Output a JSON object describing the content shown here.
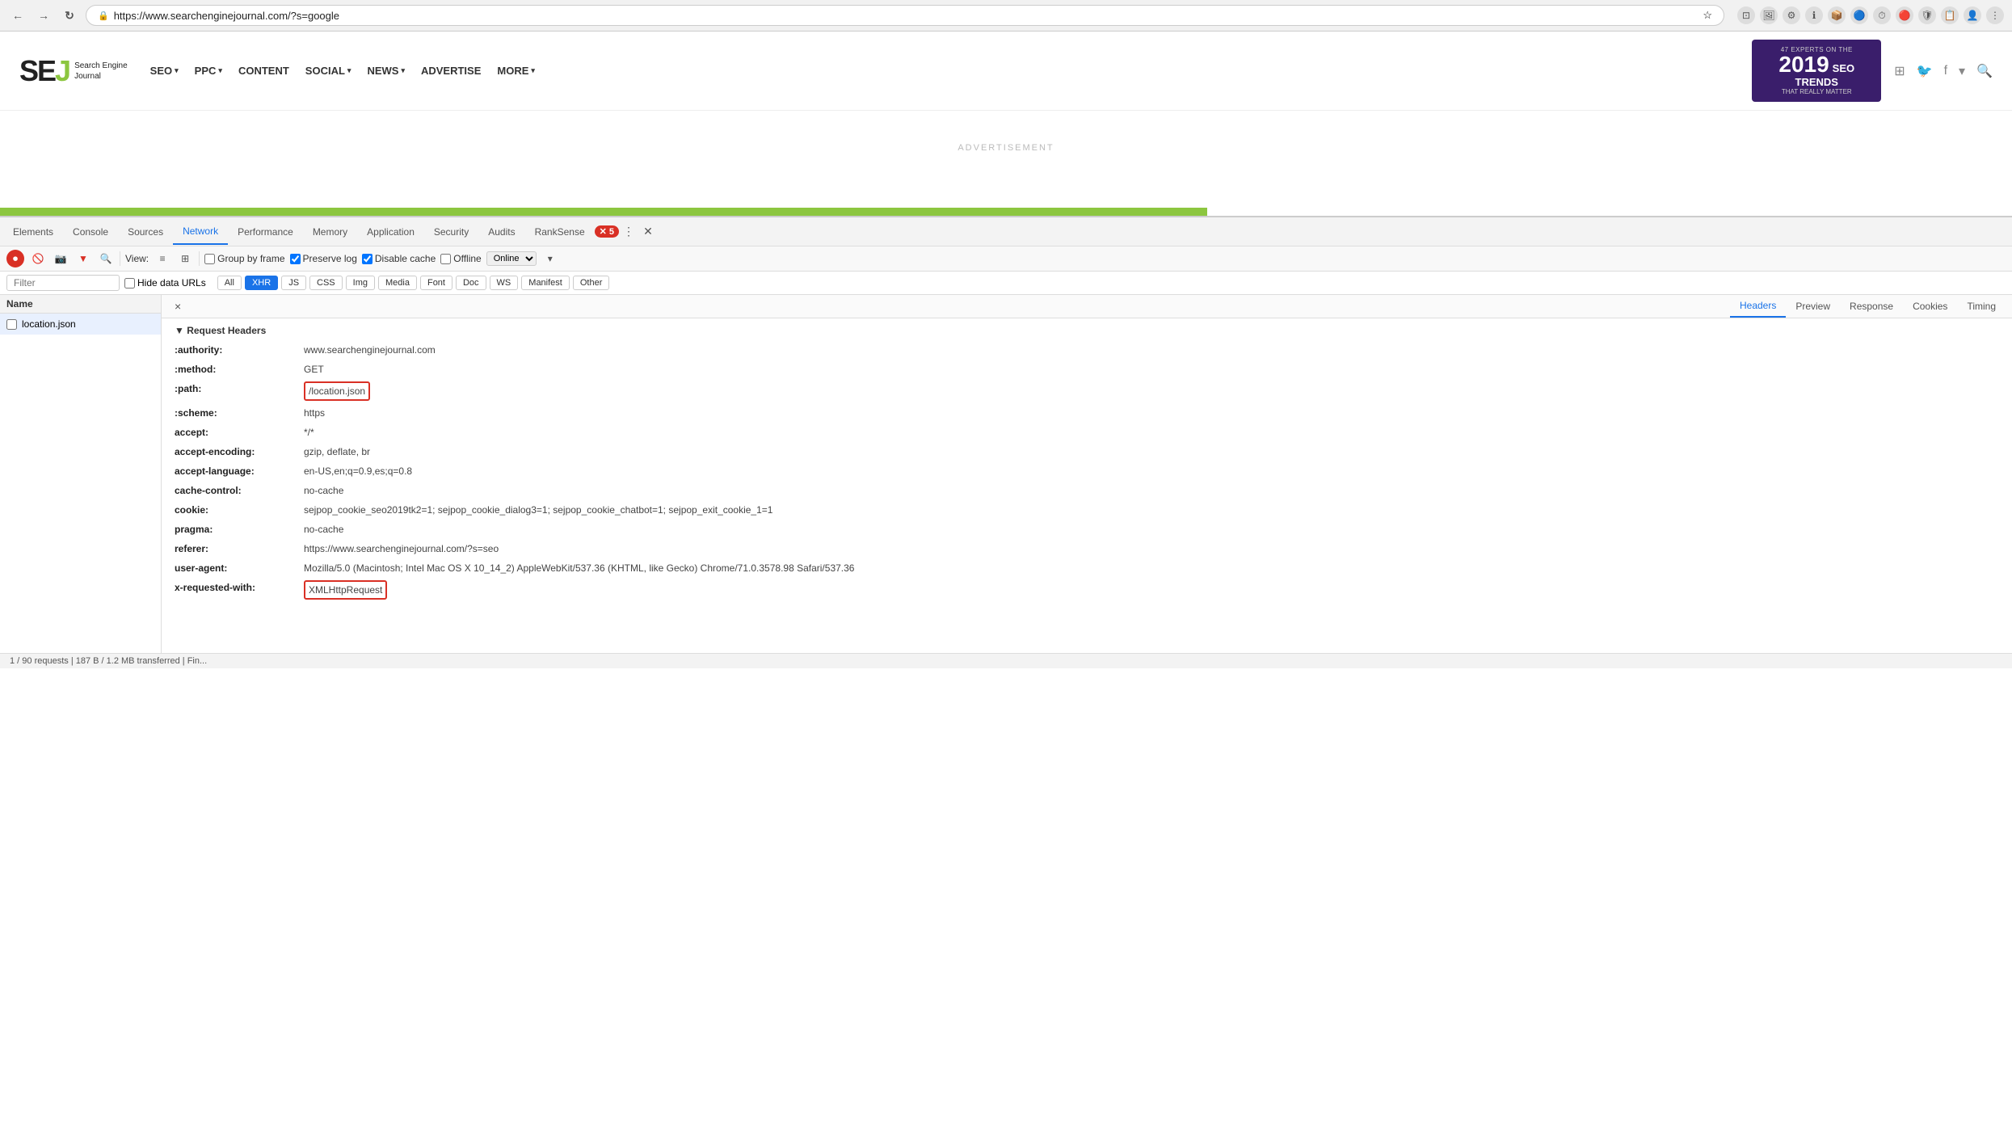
{
  "browser": {
    "url": "https://www.searchenginejournal.com/?s=google",
    "back_label": "←",
    "forward_label": "→",
    "reload_label": "↻",
    "lock_icon": "🔒"
  },
  "site": {
    "logo_se": "SE",
    "logo_j": "J",
    "logo_line1": "Search Engine",
    "logo_line2": "Journal",
    "nav": [
      {
        "label": "SEO",
        "has_arrow": true
      },
      {
        "label": "PPC",
        "has_arrow": true
      },
      {
        "label": "CONTENT",
        "has_arrow": false
      },
      {
        "label": "SOCIAL",
        "has_arrow": true
      },
      {
        "label": "NEWS",
        "has_arrow": true
      },
      {
        "label": "ADVERTISE",
        "has_arrow": false
      },
      {
        "label": "MORE",
        "has_arrow": true
      }
    ],
    "banner": {
      "small_text": "47 EXPERTS ON THE",
      "year": "2019",
      "seo": "SEO",
      "trends": "TRENDS",
      "sub": "THAT REALLY MATTER"
    }
  },
  "advertisement_label": "ADVERTISEMENT",
  "devtools": {
    "tabs": [
      {
        "label": "Elements",
        "active": false
      },
      {
        "label": "Console",
        "active": false
      },
      {
        "label": "Sources",
        "active": false
      },
      {
        "label": "Network",
        "active": true
      },
      {
        "label": "Performance",
        "active": false
      },
      {
        "label": "Memory",
        "active": false
      },
      {
        "label": "Application",
        "active": false
      },
      {
        "label": "Security",
        "active": false
      },
      {
        "label": "Audits",
        "active": false
      },
      {
        "label": "RankSense",
        "active": false
      }
    ],
    "error_count": "5",
    "close_label": "✕",
    "toolbar": {
      "view_label": "View:",
      "group_by_frame": "Group by frame",
      "preserve_log": "Preserve log",
      "disable_cache": "Disable cache",
      "offline_label": "Offline",
      "online_label": "Online"
    },
    "filter": {
      "placeholder": "Filter",
      "hide_data_urls": "Hide data URLs",
      "all_btn": "All",
      "xhr_btn": "XHR",
      "js_btn": "JS",
      "css_btn": "CSS",
      "img_btn": "Img",
      "media_btn": "Media",
      "font_btn": "Font",
      "doc_btn": "Doc",
      "ws_btn": "WS",
      "manifest_btn": "Manifest",
      "other_btn": "Other"
    },
    "file_list": {
      "header": "Name",
      "files": [
        {
          "name": "location.json",
          "selected": true
        }
      ]
    },
    "headers_panel": {
      "close": "×",
      "tabs": [
        {
          "label": "Headers",
          "active": true
        },
        {
          "label": "Preview",
          "active": false
        },
        {
          "label": "Response",
          "active": false
        },
        {
          "label": "Cookies",
          "active": false
        },
        {
          "label": "Timing",
          "active": false
        }
      ],
      "section_title": "▼ Request Headers",
      "headers": [
        {
          "key": ":authority:",
          "value": "www.searchenginejournal.com",
          "highlighted": false
        },
        {
          "key": ":method:",
          "value": "GET",
          "highlighted": false
        },
        {
          "key": ":path:",
          "value": "/location.json",
          "highlighted": true
        },
        {
          "key": ":scheme:",
          "value": "https",
          "highlighted": false
        },
        {
          "key": "accept:",
          "value": "*/*",
          "highlighted": false
        },
        {
          "key": "accept-encoding:",
          "value": "gzip, deflate, br",
          "highlighted": false
        },
        {
          "key": "accept-language:",
          "value": "en-US,en;q=0.9,es;q=0.8",
          "highlighted": false
        },
        {
          "key": "cache-control:",
          "value": "no-cache",
          "highlighted": false
        },
        {
          "key": "cookie:",
          "value": "sejpop_cookie_seo2019tk2=1; sejpop_cookie_dialog3=1; sejpop_cookie_chatbot=1; sejpop_exit_cookie_1=1",
          "highlighted": false
        },
        {
          "key": "pragma:",
          "value": "no-cache",
          "highlighted": false
        },
        {
          "key": "referer:",
          "value": "https://www.searchenginejournal.com/?s=seo",
          "highlighted": false
        },
        {
          "key": "user-agent:",
          "value": "Mozilla/5.0 (Macintosh; Intel Mac OS X 10_14_2) AppleWebKit/537.36 (KHTML, like Gecko) Chrome/71.0.3578.98 Safari/537.36",
          "highlighted": false
        },
        {
          "key": "x-requested-with:",
          "value": "XMLHttpRequest",
          "highlighted": true
        }
      ]
    }
  },
  "status_bar": {
    "text": "1 / 90 requests | 187 B / 1.2 MB transferred | Fin..."
  }
}
